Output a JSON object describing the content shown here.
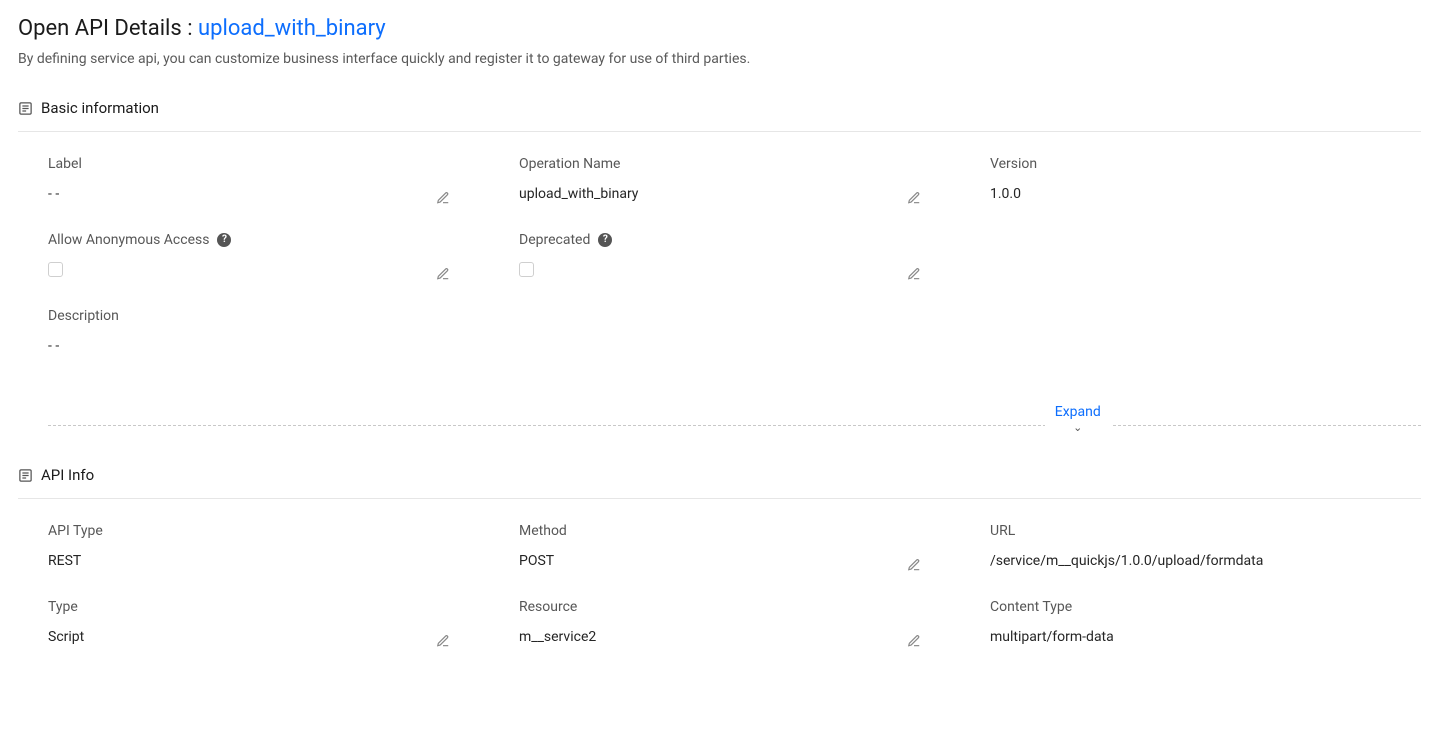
{
  "header": {
    "title_prefix": "Open API Details : ",
    "api_name": "upload_with_binary",
    "subtitle": "By defining service api, you can customize business interface quickly and register it to gateway for use of third parties."
  },
  "sections": {
    "basic": {
      "title": "Basic information",
      "labels": {
        "label": "Label",
        "operation_name": "Operation Name",
        "version": "Version",
        "allow_anon": "Allow Anonymous Access",
        "deprecated": "Deprecated",
        "description": "Description"
      },
      "values": {
        "label": "- -",
        "operation_name": "upload_with_binary",
        "version": "1.0.0",
        "description": "- -"
      },
      "expand": "Expand"
    },
    "api_info": {
      "title": "API Info",
      "labels": {
        "api_type": "API Type",
        "method": "Method",
        "url": "URL",
        "type": "Type",
        "resource": "Resource",
        "content_type": "Content Type"
      },
      "values": {
        "api_type": "REST",
        "method": "POST",
        "url": "/service/m__quickjs/1.0.0/upload/formdata",
        "type": "Script",
        "resource": "m__service2",
        "content_type": "multipart/form-data"
      }
    }
  }
}
